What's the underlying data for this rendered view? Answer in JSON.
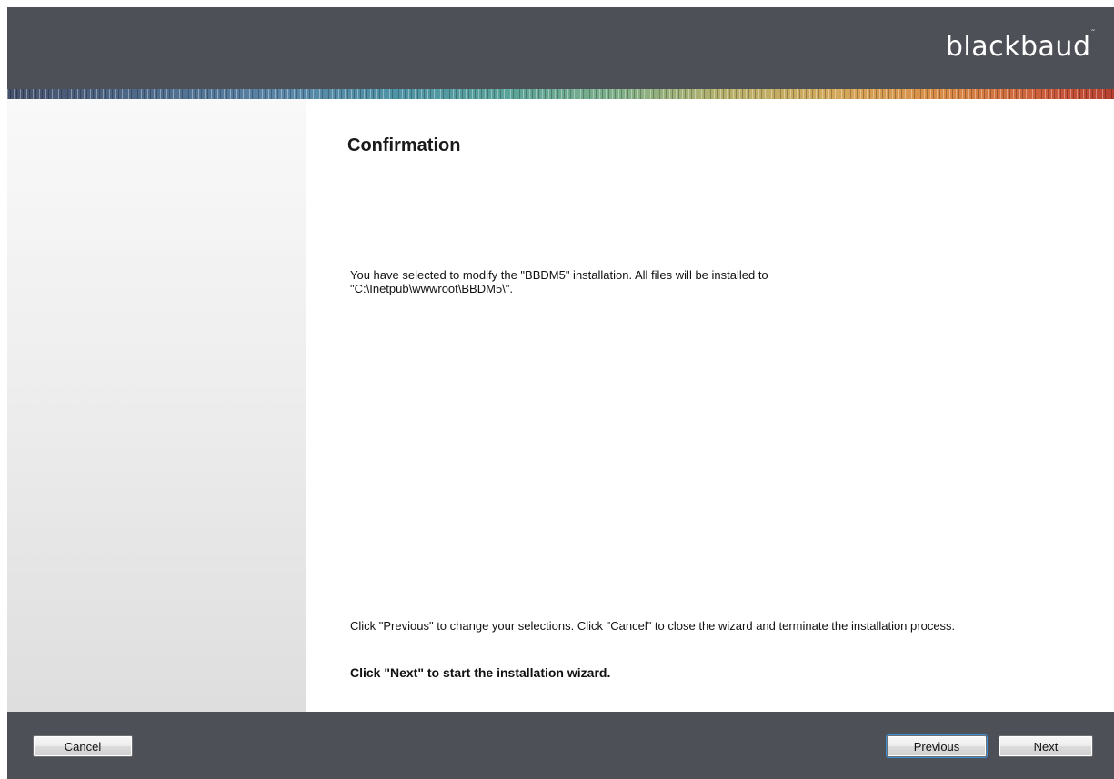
{
  "header": {
    "logo_text": "blackbaud",
    "logo_mark": "˜"
  },
  "page": {
    "title": "Confirmation",
    "message": "You have selected to modify the \"BBDM5\" installation.  All files will be installed to \"C:\\Inetpub\\wwwroot\\BBDM5\\\".",
    "footer_note": "Click  \"Previous\" to change your selections.   Click \"Cancel\" to close the wizard and terminate the installation process.",
    "footer_strong": "Click \"Next\" to start the installation wizard."
  },
  "buttons": {
    "cancel_label": "Cancel",
    "previous_label": "Previous",
    "next_label": "Next"
  },
  "colors": {
    "header_bg": "#4d5056",
    "footer_bg": "#4d5056",
    "focus_ring": "#3a8fd8"
  }
}
